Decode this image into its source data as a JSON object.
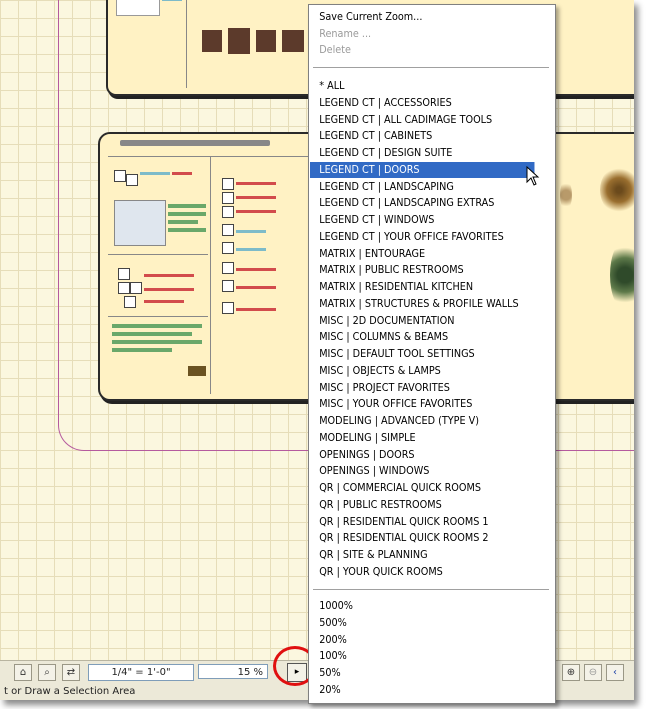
{
  "menu": {
    "top_items": [
      {
        "label": "Save Current Zoom...",
        "enabled": true
      },
      {
        "label": "Rename ...",
        "enabled": false
      },
      {
        "label": "Delete",
        "enabled": false
      }
    ],
    "zoom_sets": [
      "* ALL",
      "LEGEND CT | ACCESSORIES",
      "LEGEND CT | ALL CADIMAGE TOOLS",
      "LEGEND CT | CABINETS",
      "LEGEND CT | DESIGN SUITE",
      "LEGEND CT | DOORS",
      "LEGEND CT | LANDSCAPING",
      "LEGEND CT | LANDSCAPING EXTRAS",
      "LEGEND CT | WINDOWS",
      "LEGEND CT | YOUR OFFICE FAVORITES",
      "MATRIX | ENTOURAGE",
      "MATRIX | PUBLIC RESTROOMS",
      "MATRIX | RESIDENTIAL KITCHEN",
      "MATRIX | STRUCTURES & PROFILE WALLS",
      "MISC | 2D DOCUMENTATION",
      "MISC | COLUMNS & BEAMS",
      "MISC | DEFAULT TOOL SETTINGS",
      "MISC | OBJECTS & LAMPS",
      "MISC | PROJECT FAVORITES",
      "MISC | YOUR OFFICE FAVORITES",
      "MODELING | ADVANCED (TYPE V)",
      "MODELING | SIMPLE",
      "OPENINGS | DOORS",
      "OPENINGS | WINDOWS",
      "QR | COMMERCIAL QUICK ROOMS",
      "QR | PUBLIC RESTROOMS",
      "QR | RESIDENTIAL QUICK ROOMS 1",
      "QR | RESIDENTIAL QUICK ROOMS 2",
      "QR | SITE & PLANNING",
      "QR | YOUR QUICK ROOMS"
    ],
    "selected_zoom_set": "LEGEND CT | DOORS",
    "zoom_levels": [
      "1000%",
      "500%",
      "200%",
      "100%",
      "50%",
      "20%"
    ]
  },
  "toolbar": {
    "scale_value": "1/4\"   =   1'-0\"",
    "zoom_value": "15 %",
    "menu_arrow": "▸"
  },
  "status": {
    "text": "t or Draw a Selection Area"
  },
  "colors": {
    "selection": "#316ac5",
    "highlight_circle": "#e01010",
    "canvas": "#fbf7df",
    "boundary": "#b55a9e"
  }
}
